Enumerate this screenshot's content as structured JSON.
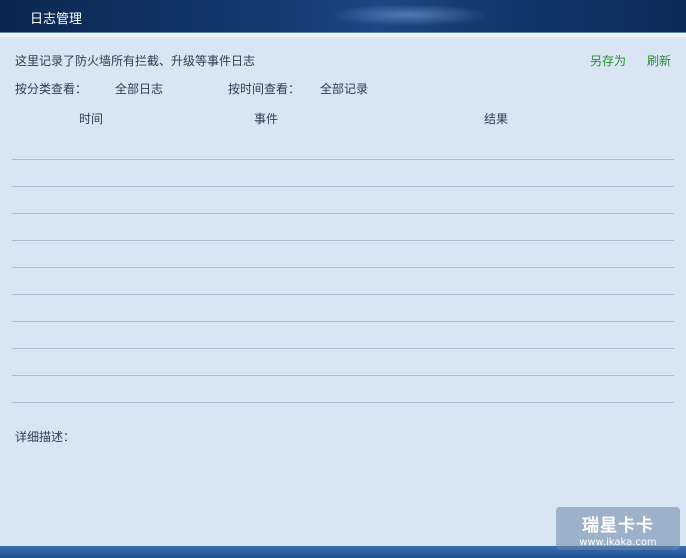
{
  "window": {
    "title": "日志管理"
  },
  "description": "这里记录了防火墙所有拦截、升级等事件日志",
  "actions": {
    "save_as": "另存为",
    "refresh": "刷新"
  },
  "filters": {
    "category_label": "按分类查看：",
    "category_value": "全部日志",
    "time_label": "按时间查看：",
    "time_value": "全部记录"
  },
  "table": {
    "columns": [
      "时间",
      "事件",
      "结果"
    ],
    "rows": []
  },
  "details": {
    "label": "详细描述："
  },
  "watermark": {
    "brand": "瑞星卡卡",
    "url": "www.ikaka.com"
  }
}
